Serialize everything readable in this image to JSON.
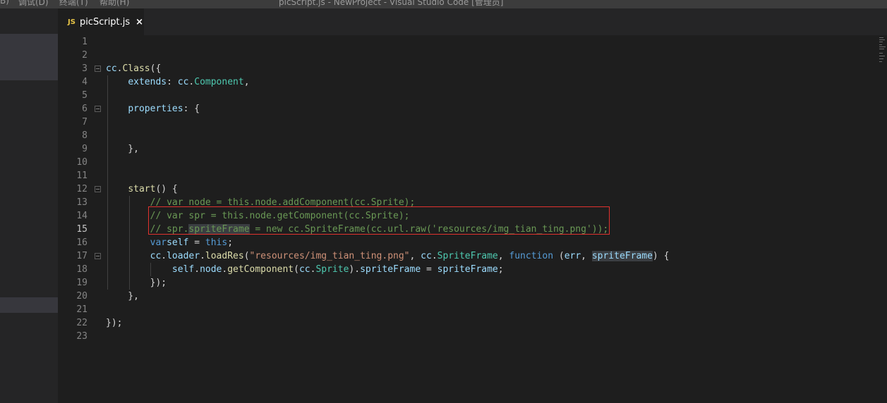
{
  "titlebar": {
    "menu": [
      "B)",
      "调试(D)",
      "终端(T)",
      "帮助(H)"
    ],
    "window_title": "picScript.js - NewProject - Visual Studio Code [管理员]"
  },
  "tab": {
    "icon": "JS",
    "label": "picScript.js",
    "close": "×"
  },
  "lines": [
    {
      "n": "1",
      "active": false,
      "tokens": []
    },
    {
      "n": "2",
      "active": false,
      "tokens": []
    },
    {
      "n": "3",
      "active": false,
      "fold": true,
      "tokens": [
        [
          "t-var",
          "cc"
        ],
        [
          "",
          "."
        ],
        [
          "t-fn",
          "Class"
        ],
        [
          "",
          "({"
        ]
      ]
    },
    {
      "n": "4",
      "active": false,
      "tokens": [
        [
          "",
          "    "
        ],
        [
          "t-prop",
          "extends"
        ],
        [
          "",
          ": "
        ],
        [
          "t-var",
          "cc"
        ],
        [
          "",
          "."
        ],
        [
          "t-cls",
          "Component"
        ],
        [
          "",
          ","
        ]
      ]
    },
    {
      "n": "5",
      "active": false,
      "tokens": []
    },
    {
      "n": "6",
      "active": false,
      "fold": true,
      "tokens": [
        [
          "",
          "    "
        ],
        [
          "t-prop",
          "properties"
        ],
        [
          "",
          ": {"
        ]
      ]
    },
    {
      "n": "7",
      "active": false,
      "tokens": []
    },
    {
      "n": "8",
      "active": false,
      "tokens": []
    },
    {
      "n": "9",
      "active": false,
      "tokens": [
        [
          "",
          "    },"
        ]
      ]
    },
    {
      "n": "10",
      "active": false,
      "tokens": []
    },
    {
      "n": "11",
      "active": false,
      "tokens": []
    },
    {
      "n": "12",
      "active": false,
      "fold": true,
      "tokens": [
        [
          "",
          "    "
        ],
        [
          "t-fn",
          "start"
        ],
        [
          "",
          "() {"
        ]
      ]
    },
    {
      "n": "13",
      "active": false,
      "tokens": [
        [
          "",
          "        "
        ],
        [
          "t-com",
          "// var node = this.node.addComponent(cc.Sprite);"
        ]
      ]
    },
    {
      "n": "14",
      "active": false,
      "tokens": [
        [
          "",
          "        "
        ],
        [
          "t-com",
          "// var spr = this.node.getComponent(cc.Sprite);"
        ]
      ]
    },
    {
      "n": "15",
      "active": true,
      "tokens": [
        [
          "",
          "        "
        ],
        [
          "t-com",
          "// spr."
        ],
        [
          "t-com t-hl",
          "spriteFrame"
        ],
        [
          "t-com",
          " = new cc.SpriteFrame(cc.url.raw('resources/img_tian_ting.png'));"
        ]
      ]
    },
    {
      "n": "16",
      "active": false,
      "tokens": [
        [
          "",
          "        "
        ],
        [
          "t-kw",
          "var"
        ],
        [
          "",
          "",
          " "
        ],
        [
          "t-var",
          "self"
        ],
        [
          "",
          " = "
        ],
        [
          "t-kw",
          "this"
        ],
        [
          "",
          ";"
        ]
      ]
    },
    {
      "n": "17",
      "active": false,
      "fold": true,
      "tokens": [
        [
          "",
          "        "
        ],
        [
          "t-var",
          "cc"
        ],
        [
          "",
          "."
        ],
        [
          "t-var",
          "loader"
        ],
        [
          "",
          "."
        ],
        [
          "t-fn",
          "loadRes"
        ],
        [
          "",
          "("
        ],
        [
          "t-str",
          "\"resources/img_tian_ting.png\""
        ],
        [
          "",
          ", "
        ],
        [
          "t-var",
          "cc"
        ],
        [
          "",
          "."
        ],
        [
          "t-cls",
          "SpriteFrame"
        ],
        [
          "",
          ", "
        ],
        [
          "t-kw",
          "function"
        ],
        [
          "",
          " ("
        ],
        [
          "t-var",
          "err"
        ],
        [
          "",
          ", "
        ],
        [
          "t-var t-hl",
          "spriteFrame"
        ],
        [
          "",
          ") {"
        ]
      ]
    },
    {
      "n": "18",
      "active": false,
      "tokens": [
        [
          "",
          "            "
        ],
        [
          "t-var",
          "self"
        ],
        [
          "",
          "."
        ],
        [
          "t-var",
          "node"
        ],
        [
          "",
          "."
        ],
        [
          "t-fn",
          "getComponent"
        ],
        [
          "",
          "("
        ],
        [
          "t-var",
          "cc"
        ],
        [
          "",
          "."
        ],
        [
          "t-cls",
          "Sprite"
        ],
        [
          "",
          ")."
        ],
        [
          "t-var",
          "spriteFrame"
        ],
        [
          "",
          " = "
        ],
        [
          "t-var",
          "spriteFrame"
        ],
        [
          "",
          ";"
        ]
      ]
    },
    {
      "n": "19",
      "active": false,
      "tokens": [
        [
          "",
          "        });"
        ]
      ]
    },
    {
      "n": "20",
      "active": false,
      "tokens": [
        [
          "",
          "    },"
        ]
      ]
    },
    {
      "n": "21",
      "active": false,
      "tokens": []
    },
    {
      "n": "22",
      "active": false,
      "tokens": [
        [
          "",
          "});"
        ]
      ]
    },
    {
      "n": "23",
      "active": false,
      "tokens": []
    }
  ]
}
